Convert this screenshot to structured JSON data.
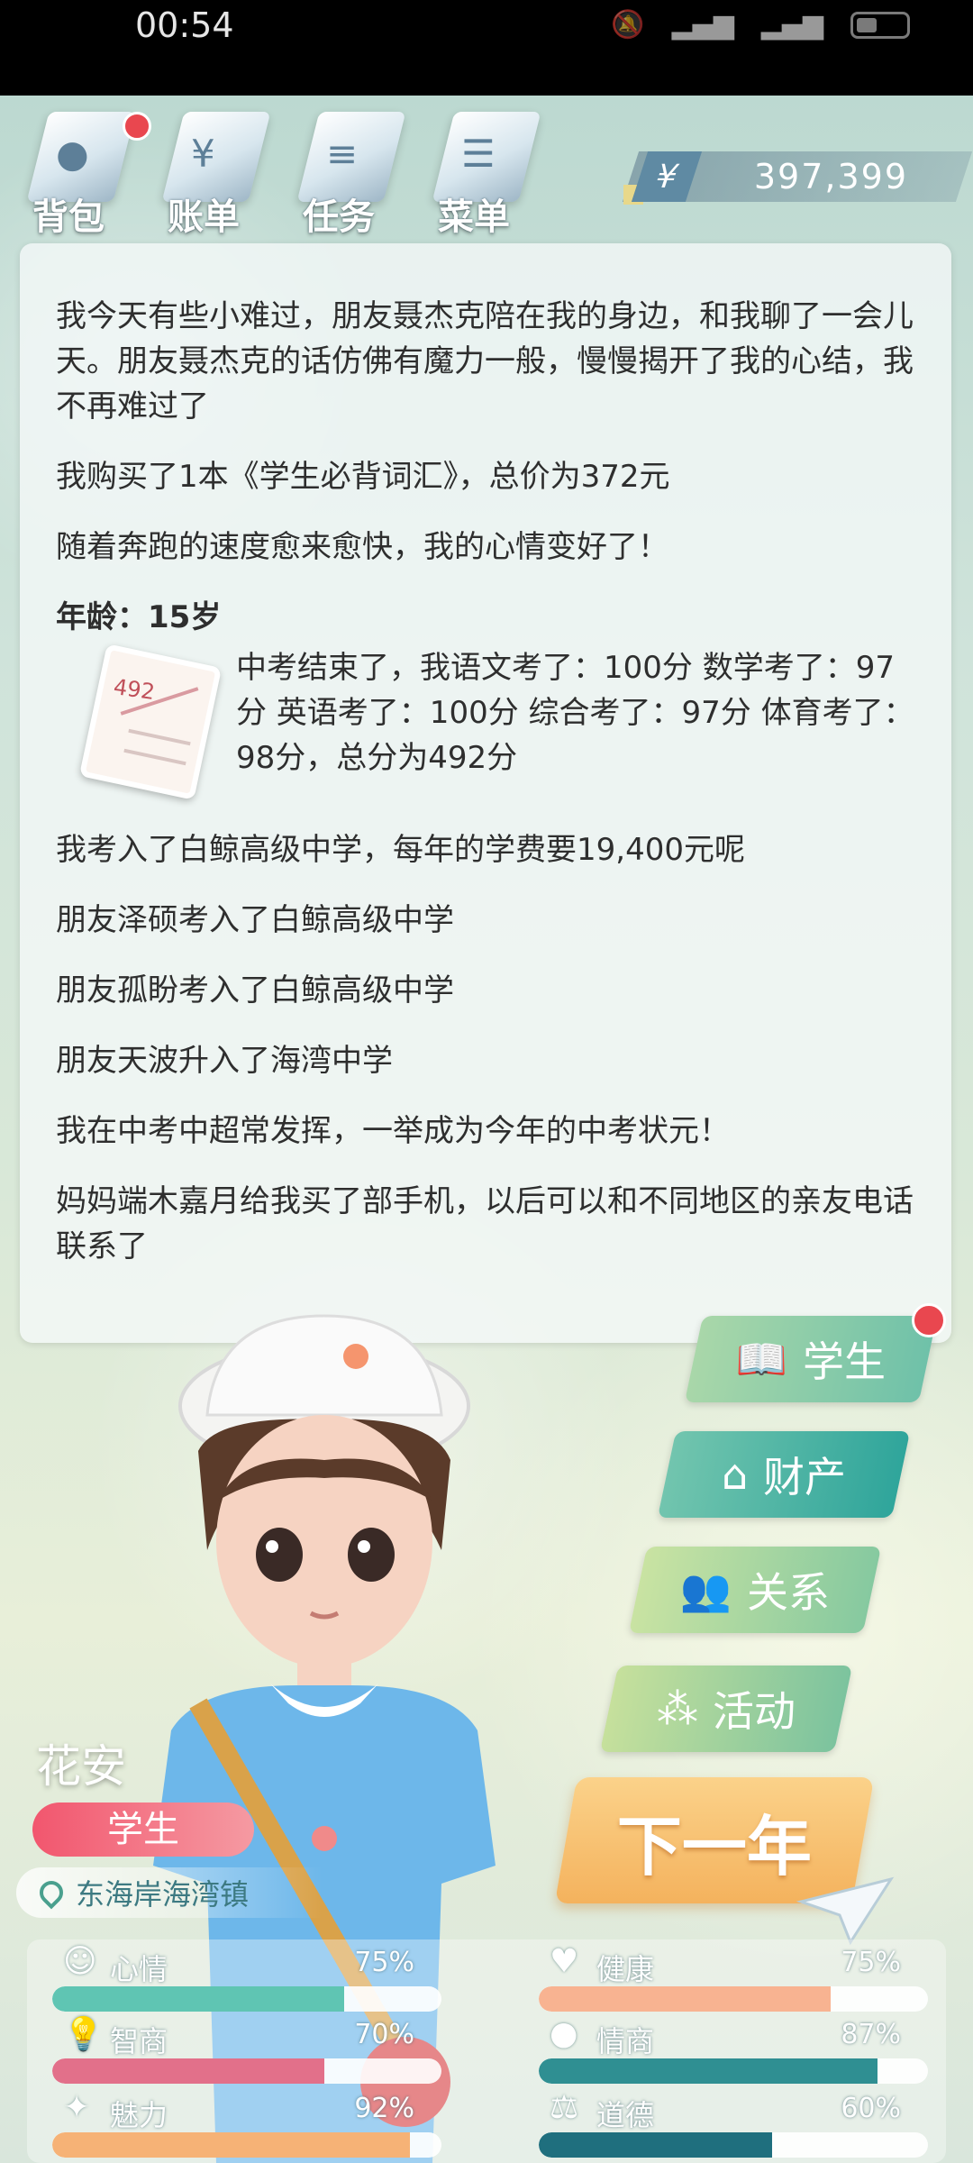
{
  "status_bar": {
    "time": "00:54"
  },
  "toolbar": {
    "items": [
      {
        "label": "背包",
        "icon": "bag-icon"
      },
      {
        "label": "账单",
        "icon": "bill-icon"
      },
      {
        "label": "任务",
        "icon": "task-icon"
      },
      {
        "label": "菜单",
        "icon": "menu-icon"
      }
    ],
    "money": {
      "currency_symbol": "¥",
      "amount": "397,399"
    }
  },
  "log": {
    "entries_top": [
      "我今天有些小难过，朋友聂杰克陪在我的身边，和我聊了一会儿天。朋友聂杰克的话仿佛有魔力一般，慢慢揭开了我的心结，我不再难过了",
      "我购买了1本《学生必背词汇》，总价为372元",
      "随着奔跑的速度愈来愈快，我的心情变好了！"
    ],
    "age_heading": "年龄：15岁",
    "exam_paper_score": "492",
    "exam_text": "中考结束了，我语文考了：100分  数学考了：97分  英语考了：100分  综合考了：97分  体育考了：98分，总分为492分",
    "entries_bottom": [
      "我考入了白鲸高级中学，每年的学费要19,400元呢",
      "朋友泽硕考入了白鲸高级中学",
      "朋友孤盼考入了白鲸高级中学",
      "朋友天波升入了海湾中学",
      "我在中考中超常发挥，一举成为今年的中考状元！",
      "妈妈端木嘉月给我买了部手机，以后可以和不同地区的亲友电话联系了"
    ]
  },
  "character": {
    "name": "花安",
    "role": "学生",
    "location": "东海岸海湾镇"
  },
  "side_menu": {
    "student": "学生",
    "assets": "财产",
    "relations": "关系",
    "activities": "活动",
    "next_year": "下一年"
  },
  "stats": [
    {
      "label": "心情",
      "percent_text": "75%",
      "value": 0.75,
      "color": "#5fc5b3",
      "icon": "smiley-icon"
    },
    {
      "label": "智商",
      "percent_text": "70%",
      "value": 0.7,
      "color": "#e2708a",
      "icon": "bulb-icon"
    },
    {
      "label": "魅力",
      "percent_text": "92%",
      "value": 0.92,
      "color": "#f6b276",
      "icon": "sparkle-icon"
    },
    {
      "label": "健康",
      "percent_text": "75%",
      "value": 0.75,
      "color": "#f8b391",
      "icon": "heart-icon"
    },
    {
      "label": "情商",
      "percent_text": "87%",
      "value": 0.87,
      "color": "#2f8f92",
      "icon": "apple-icon"
    },
    {
      "label": "道德",
      "percent_text": "60%",
      "value": 0.6,
      "color": "#1f6f7e",
      "icon": "scales-icon"
    }
  ]
}
